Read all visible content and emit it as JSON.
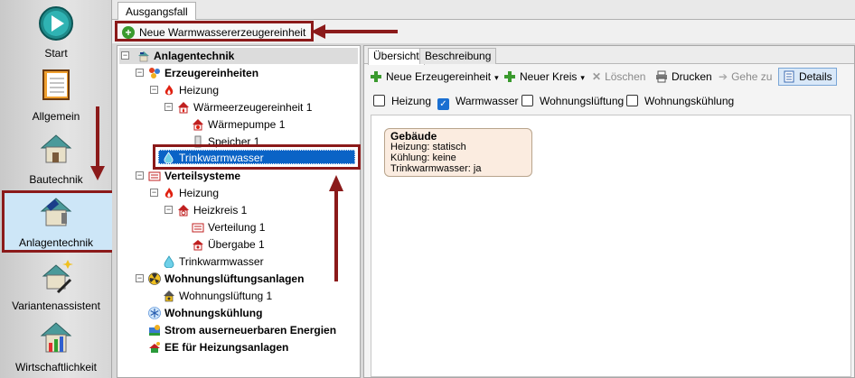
{
  "nav": {
    "items": [
      {
        "label": "Start"
      },
      {
        "label": "Allgemein"
      },
      {
        "label": "Bautechnik"
      },
      {
        "label": "Anlagentechnik"
      },
      {
        "label": "Variantenassistent"
      },
      {
        "label": "Wirtschaftlichkeit"
      }
    ],
    "selected": "Anlagentechnik"
  },
  "tabstrip": {
    "tab": "Ausgangsfall"
  },
  "toolbar": {
    "new_button": "Neue Warmwassererzeugereinheit"
  },
  "tree": {
    "root": "Anlagentechnik",
    "erzeugereinheiten": "Erzeugereinheiten",
    "heizung": "Heizung",
    "waermeerzeuger": "Wärmeerzeugereinheit 1",
    "waermepumpe": "Wärmepumpe 1",
    "speicher": "Speicher 1",
    "trinkwarmwasser_selected": "Trinkwarmwasser",
    "verteilsysteme": "Verteilsysteme",
    "verteil_heizung": "Heizung",
    "heizkreis": "Heizkreis 1",
    "verteilung": "Verteilung 1",
    "uebergabe": "Übergabe 1",
    "verteil_trinkwarmwasser": "Trinkwarmwasser",
    "wohnungslueftungsanlagen": "Wohnungslüftungsanlagen",
    "wohnungslueftung": "Wohnungslüftung 1",
    "wohnungskuehlung": "Wohnungskühlung",
    "strom": "Strom auserneuerbaren Energien",
    "ee": "EE für Heizungsanlagen"
  },
  "content": {
    "tabs": [
      "Übersicht",
      "Beschreibung"
    ],
    "active_tab": "Übersicht",
    "toolbar": {
      "neue_erzeugereinheit": "Neue Erzeugereinheit",
      "neuer_kreis": "Neuer Kreis",
      "loeschen": "Löschen",
      "drucken": "Drucken",
      "gehe_zu": "Gehe zu",
      "details": "Details"
    },
    "filters": [
      {
        "label": "Heizung",
        "checked": false
      },
      {
        "label": "Warmwasser",
        "checked": true
      },
      {
        "label": "Wohnungslüftung",
        "checked": false
      },
      {
        "label": "Wohnungskühlung",
        "checked": false
      }
    ],
    "card": {
      "title": "Gebäude",
      "line1": "Heizung: statisch",
      "line2": "Kühlung: keine",
      "line3": "Trinkwarmwasser: ja"
    }
  },
  "colors": {
    "highlight": "#8b1a1a",
    "selection": "#0a63c6",
    "accent_green": "#3a9a2e"
  }
}
